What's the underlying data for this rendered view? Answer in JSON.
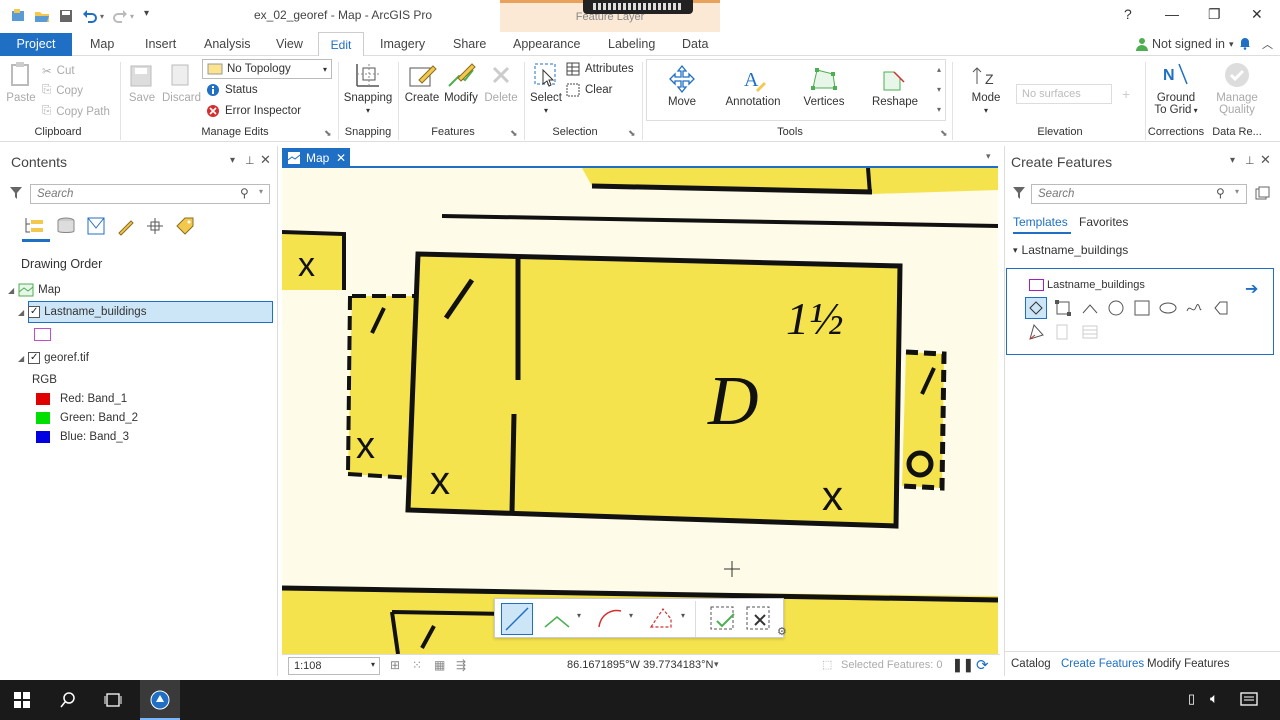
{
  "window": {
    "title": "ex_02_georef - Map - ArcGIS Pro",
    "context_tab": "Feature Layer",
    "help": "?",
    "minimize": "—",
    "maximize": "❐",
    "close": "✕"
  },
  "tabs": {
    "project": "Project",
    "map": "Map",
    "insert": "Insert",
    "analysis": "Analysis",
    "view": "View",
    "edit": "Edit",
    "imagery": "Imagery",
    "share": "Share",
    "appearance": "Appearance",
    "labeling": "Labeling",
    "data": "Data",
    "signin": "Not signed in",
    "signin_caret": "▾"
  },
  "ribbon": {
    "clipboard": {
      "paste": "Paste",
      "cut": "Cut",
      "copy": "Copy",
      "copy_path": "Copy Path",
      "label": "Clipboard"
    },
    "manage_edits": {
      "save": "Save",
      "discard": "Discard",
      "topology": "No Topology",
      "status": "Status",
      "error_inspector": "Error Inspector",
      "label": "Manage Edits"
    },
    "snapping": {
      "button": "Snapping",
      "label": "Snapping"
    },
    "features": {
      "create": "Create",
      "modify": "Modify",
      "delete": "Delete",
      "label": "Features"
    },
    "selection": {
      "select": "Select",
      "attributes": "Attributes",
      "clear": "Clear",
      "label": "Selection"
    },
    "tools": {
      "move": "Move",
      "annotation": "Annotation",
      "vertices": "Vertices",
      "reshape": "Reshape",
      "label": "Tools"
    },
    "elevation": {
      "mode": "Mode",
      "surface_placeholder": "No surfaces",
      "label": "Elevation"
    },
    "corrections": {
      "ground_to_grid": "Ground",
      "ground_to_grid2": "To Grid",
      "label": "Corrections"
    },
    "data_reviewer": {
      "manage_quality": "Manage",
      "manage_quality2": "Quality",
      "label": "Data Re..."
    }
  },
  "contents": {
    "title": "Contents",
    "search_placeholder": "Search",
    "drawing_order": "Drawing Order",
    "map": "Map",
    "layer1": "Lastname_buildings",
    "layer2": "georef.tif",
    "rgb": "RGB",
    "bands": [
      {
        "label": "Red:  Band_1",
        "color": "#e00000"
      },
      {
        "label": "Green: Band_2",
        "color": "#00e000"
      },
      {
        "label": "Blue:  Band_3",
        "color": "#0000e0"
      }
    ]
  },
  "map": {
    "tab": "Map",
    "labels": {
      "half": "1½",
      "d": "D"
    },
    "scale": "1:108",
    "coordinates": "86.1671895°W 39.7734183°N",
    "selected_features": "Selected Features: 0"
  },
  "create_features": {
    "title": "Create Features",
    "search_placeholder": "Search",
    "tab_templates": "Templates",
    "tab_favorites": "Favorites",
    "group": "Lastname_buildings",
    "template": "Lastname_buildings",
    "accent_color": "#1f6fc5"
  },
  "bottom_tabs": {
    "catalog": "Catalog",
    "create_features": "Create Features",
    "modify_features": "Modify Features"
  }
}
